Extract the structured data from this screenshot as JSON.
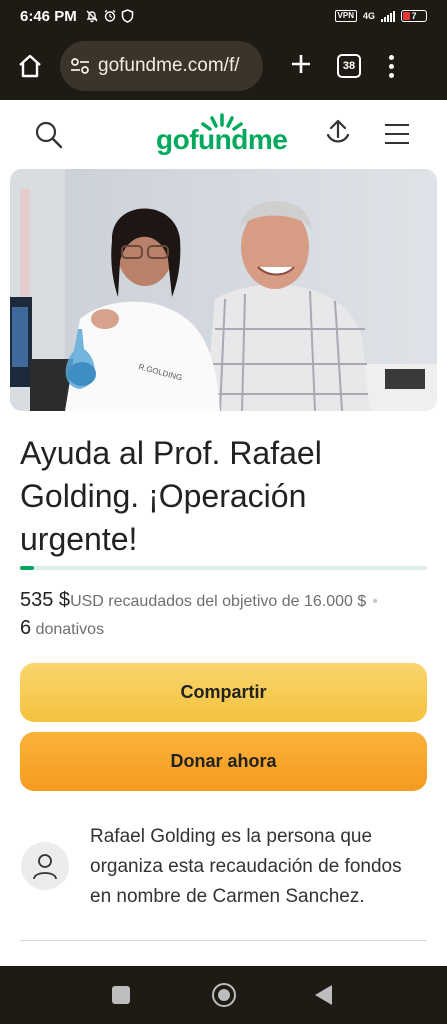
{
  "status_bar": {
    "time": "6:46 PM",
    "vpn": "VPN",
    "network": "4G",
    "battery": "7"
  },
  "browser": {
    "url": "gofundme.com/f/",
    "tab_count": "38"
  },
  "site": {
    "logo_text": "gofundme"
  },
  "campaign": {
    "title": "Ayuda al Prof. Rafael Golding. ¡Operación urgente!",
    "progress_fraction": 0.034,
    "raised_amount": "535 $",
    "raised_currency": "USD",
    "raised_text": " recaudados del objetivo de 16.000 $",
    "separator": "•",
    "donations_count": "6",
    "donations_label": " donativos",
    "photo_coat_text": "R.GOLDING"
  },
  "actions": {
    "share_label": "Compartir",
    "donate_label": "Donar ahora"
  },
  "organizer": {
    "text": "Rafael Golding es la persona que organiza esta recaudación de fondos en nombre de Carmen Sanchez."
  },
  "colors": {
    "brand_green": "#02a95c",
    "share_yellow": "#f6c94f",
    "donate_orange": "#f9a52c",
    "system_bar": "#1e1a14"
  }
}
